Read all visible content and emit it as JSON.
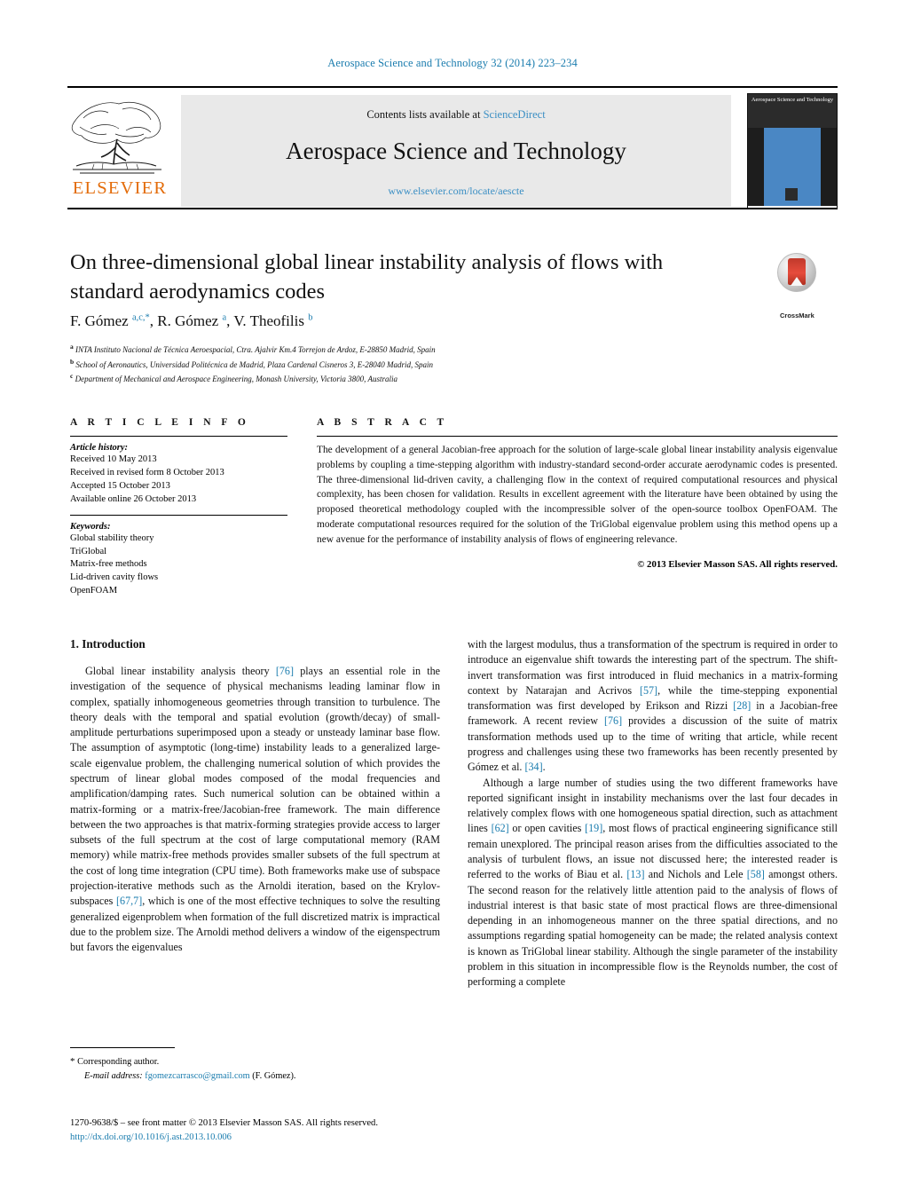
{
  "running_head": "Aerospace Science and Technology 32 (2014) 223–234",
  "masthead": {
    "contents_prefix": "Contents lists available at ",
    "sciencedirect": "ScienceDirect",
    "journal_title": "Aerospace Science and Technology",
    "journal_url": "www.elsevier.com/locate/aescte",
    "publisher": "ELSEVIER",
    "cover_label": "Aerospace Science and Technology"
  },
  "article": {
    "title": "On three-dimensional global linear instability analysis of flows with standard aerodynamics codes",
    "crossmark_label": "CrossMark",
    "authors_html": "F. Gómez <sup>a,c,*</sup>, R. Gómez <sup>a</sup>, V. Theofilis <sup>b</sup>",
    "affiliations": [
      {
        "marker": "a",
        "text": "INTA Instituto Nacional de Técnica Aeroespacial, Ctra. Ajalvir Km.4 Torrejon de Ardoz, E-28850 Madrid, Spain"
      },
      {
        "marker": "b",
        "text": "School of Aeronautics, Universidad Politécnica de Madrid, Plaza Cardenal Cisneros 3, E-28040 Madrid, Spain"
      },
      {
        "marker": "c",
        "text": "Department of Mechanical and Aerospace Engineering, Monash University, Victoria 3800, Australia"
      }
    ]
  },
  "article_info": {
    "heading": "A R T I C L E   I N F O",
    "history_label": "Article history:",
    "history": [
      "Received 10 May 2013",
      "Received in revised form 8 October 2013",
      "Accepted 15 October 2013",
      "Available online 26 October 2013"
    ],
    "keywords_label": "Keywords:",
    "keywords": [
      "Global stability theory",
      "TriGlobal",
      "Matrix-free methods",
      "Lid-driven cavity flows",
      "OpenFOAM"
    ]
  },
  "abstract": {
    "heading": "A B S T R A C T",
    "text": "The development of a general Jacobian-free approach for the solution of large-scale global linear instability analysis eigenvalue problems by coupling a time-stepping algorithm with industry-standard second-order accurate aerodynamic codes is presented. The three-dimensional lid-driven cavity, a challenging flow in the context of required computational resources and physical complexity, has been chosen for validation. Results in excellent agreement with the literature have been obtained by using the proposed theoretical methodology coupled with the incompressible solver of the open-source toolbox OpenFOAM. The moderate computational resources required for the solution of the TriGlobal eigenvalue problem using this method opens up a new avenue for the performance of instability analysis of flows of engineering relevance.",
    "copyright": "© 2013 Elsevier Masson SAS. All rights reserved."
  },
  "body": {
    "section_heading": "1. Introduction",
    "left_paragraph_1_a": "Global linear instability analysis theory ",
    "left_paragraph_1_ref1": "[76]",
    "left_paragraph_1_b": " plays an essential role in the investigation of the sequence of physical mechanisms leading laminar flow in complex, spatially inhomogeneous geometries through transition to turbulence. The theory deals with the temporal and spatial evolution (growth/decay) of small-amplitude perturbations superimposed upon a steady or unsteady laminar base flow. The assumption of asymptotic (long-time) instability leads to a generalized large-scale eigenvalue problem, the challenging numerical solution of which provides the spectrum of linear global modes composed of the modal frequencies and amplification/damping rates. Such numerical solution can be obtained within a matrix-forming or a matrix-free/Jacobian-free framework. The main difference between the two approaches is that matrix-forming strategies provide access to larger subsets of the full spectrum at the cost of large computational memory (RAM memory) while matrix-free methods provides smaller subsets of the full spectrum at the cost of long time integration (CPU time). Both frameworks make use of subspace projection-iterative methods such as the Arnoldi iteration, based on the Krylov-subspaces ",
    "left_paragraph_1_ref2": "[67,7]",
    "left_paragraph_1_c": ", which is one of the most effective techniques to solve the resulting generalized eigenproblem when formation of the full discretized matrix is impractical due to the problem size. The Arnoldi method delivers a window of the eigenspectrum but favors the eigenvalues",
    "right_paragraph_1_a": "with the largest modulus, thus a transformation of the spectrum is required in order to introduce an eigenvalue shift towards the interesting part of the spectrum. The shift-invert transformation was first introduced in fluid mechanics in a matrix-forming context by Natarajan and Acrivos ",
    "right_paragraph_1_ref1": "[57]",
    "right_paragraph_1_b": ", while the time-stepping exponential transformation was first developed by Erikson and Rizzi ",
    "right_paragraph_1_ref2": "[28]",
    "right_paragraph_1_c": " in a Jacobian-free framework. A recent review ",
    "right_paragraph_1_ref3": "[76]",
    "right_paragraph_1_d": " provides a discussion of the suite of matrix transformation methods used up to the time of writing that article, while recent progress and challenges using these two frameworks has been recently presented by Gómez et al. ",
    "right_paragraph_1_ref4": "[34]",
    "right_paragraph_1_e": ".",
    "right_paragraph_2_a": "Although a large number of studies using the two different frameworks have reported significant insight in instability mechanisms over the last four decades in relatively complex flows with one homogeneous spatial direction, such as attachment lines ",
    "right_paragraph_2_ref1": "[62]",
    "right_paragraph_2_b": " or open cavities ",
    "right_paragraph_2_ref2": "[19]",
    "right_paragraph_2_c": ", most flows of practical engineering significance still remain unexplored. The principal reason arises from the difficulties associated to the analysis of turbulent flows, an issue not discussed here; the interested reader is referred to the works of Biau et al. ",
    "right_paragraph_2_ref3": "[13]",
    "right_paragraph_2_d": " and Nichols and Lele ",
    "right_paragraph_2_ref4": "[58]",
    "right_paragraph_2_e": " amongst others. The second reason for the relatively little attention paid to the analysis of flows of industrial interest is that basic state of most practical flows are three-dimensional depending in an inhomogeneous manner on the three spatial directions, and no assumptions regarding spatial homogeneity can be made; the related analysis context is known as TriGlobal linear stability. Although the single parameter of the instability problem in this situation in incompressible flow is the Reynolds number, the cost of performing a complete"
  },
  "footnote": {
    "star": "*",
    "corresponding": "Corresponding author.",
    "email_label": "E-mail address:",
    "email": "fgomezcarrasco@gmail.com",
    "email_suffix": "(F. Gómez).",
    "issn_line": "1270-9638/$ – see front matter © 2013 Elsevier Masson SAS. All rights reserved.",
    "doi": "http://dx.doi.org/10.1016/j.ast.2013.10.006"
  },
  "colors": {
    "link": "#1a7cae",
    "elsevier_orange": "#e36c0a",
    "band_gray": "#e9e9e9"
  }
}
